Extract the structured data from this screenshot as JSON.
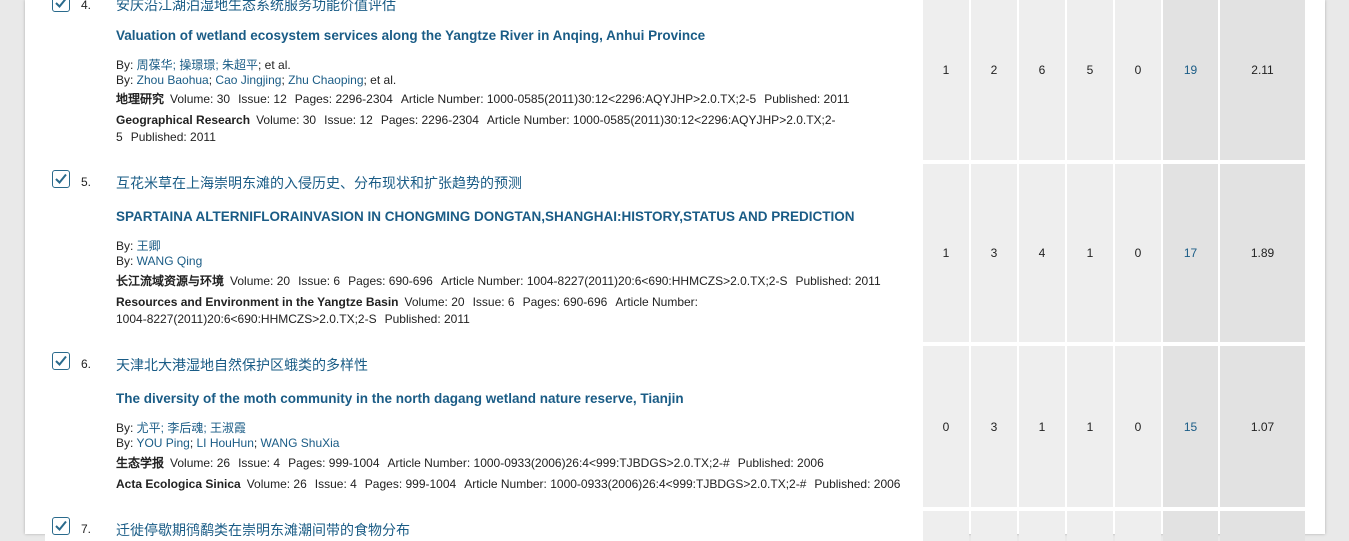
{
  "records": [
    {
      "number": "4.",
      "title_cn": "安庆沿江湖泊湿地生态系统服务功能价值评估",
      "title_en": "Valuation of wetland ecosystem services along the Yangtze River in Anqing, Anhui Province",
      "by_cn_prefix": "By: ",
      "authors_cn": "周葆华; 操璟璟; 朱超平",
      "authors_cn_suffix": "; et al.",
      "by_en_prefix": "By: ",
      "authors_en": [
        "Zhou Baohua",
        "Cao Jingjing",
        "Zhu Chaoping"
      ],
      "authors_en_suffix": "; et al.",
      "source_cn": {
        "journal": "地理研究",
        "volume": "Volume: 30",
        "issue": "Issue: 12",
        "pages": "Pages: 2296-2304",
        "article": "Article Number: 1000-0585(2011)30:12<2296:AQYJHP>2.0.TX;2-5",
        "published": "Published: 2011"
      },
      "source_en": {
        "journal": "Geographical Research",
        "volume": "Volume: 30",
        "issue": "Issue: 12",
        "pages": "Pages: 2296-2304",
        "article": "Article Number: 1000-0585(2011)30:12<2296:AQYJHP>2.0.TX;2-5",
        "published": "Published: 2011"
      },
      "counts": [
        "1",
        "2",
        "6",
        "5",
        "0",
        "19",
        "2.11"
      ]
    },
    {
      "number": "5.",
      "title_cn": "互花米草在上海崇明东滩的入侵历史、分布现状和扩张趋势的预测",
      "title_en": "SPARTAINA ALTERNIFLORAINVASION IN CHONGMING DONGTAN,SHANGHAI:HISTORY,STATUS AND PREDICTION",
      "by_cn_prefix": "By: ",
      "authors_cn": "王卿",
      "authors_cn_suffix": "",
      "by_en_prefix": "By: ",
      "authors_en": [
        "WANG Qing"
      ],
      "authors_en_suffix": "",
      "source_cn": {
        "journal": "长江流域资源与环境",
        "volume": "Volume: 20",
        "issue": "Issue: 6",
        "pages": "Pages: 690-696",
        "article": "Article Number: 1004-8227(2011)20:6<690:HHMCZS>2.0.TX;2-S",
        "published": "Published: 2011"
      },
      "source_en": {
        "journal": "Resources and Environment in the Yangtze Basin",
        "volume": "Volume: 20",
        "issue": "Issue: 6",
        "pages": "Pages: 690-696",
        "article": "Article Number: 1004-8227(2011)20:6<690:HHMCZS>2.0.TX;2-S",
        "published": "Published: 2011"
      },
      "counts": [
        "1",
        "3",
        "4",
        "1",
        "0",
        "17",
        "1.89"
      ]
    },
    {
      "number": "6.",
      "title_cn": "天津北大港湿地自然保护区蛾类的多样性",
      "title_en": "The diversity of the moth community in the north dagang wetland nature reserve, Tianjin",
      "by_cn_prefix": "By: ",
      "authors_cn": "尤平; 李后魂; 王淑霞",
      "authors_cn_suffix": "",
      "by_en_prefix": "By: ",
      "authors_en": [
        "YOU Ping",
        "LI HouHun",
        "WANG ShuXia"
      ],
      "authors_en_suffix": "",
      "source_cn": {
        "journal": "生态学报",
        "volume": "Volume: 26",
        "issue": "Issue: 4",
        "pages": "Pages: 999-1004",
        "article": "Article Number: 1000-0933(2006)26:4<999:TJBDGS>2.0.TX;2-#",
        "published": "Published: 2006"
      },
      "source_en": {
        "journal": "Acta Ecologica Sinica",
        "volume": "Volume: 26",
        "issue": "Issue: 4",
        "pages": "Pages: 999-1004",
        "article": "Article Number: 1000-0933(2006)26:4<999:TJBDGS>2.0.TX;2-#",
        "published": "Published: 2006"
      },
      "counts": [
        "0",
        "3",
        "1",
        "1",
        "0",
        "15",
        "1.07"
      ]
    },
    {
      "number": "7.",
      "title_cn": "迁徙停歇期鸻鹬类在崇明东滩潮间带的食物分布"
    }
  ]
}
